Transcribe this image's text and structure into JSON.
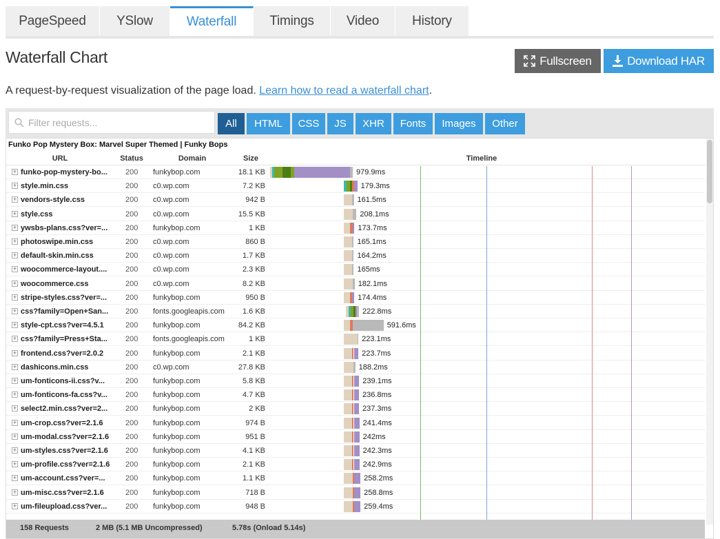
{
  "tabs": [
    {
      "label": "PageSpeed",
      "active": false
    },
    {
      "label": "YSlow",
      "active": false
    },
    {
      "label": "Waterfall",
      "active": true
    },
    {
      "label": "Timings",
      "active": false
    },
    {
      "label": "Video",
      "active": false
    },
    {
      "label": "History",
      "active": false
    }
  ],
  "heading": "Waterfall Chart",
  "buttons": {
    "fullscreen": "Fullscreen",
    "download": "Download HAR"
  },
  "description": {
    "text": "A request-by-request visualization of the page load.",
    "link": "Learn how to read a waterfall chart",
    "end": "."
  },
  "filter": {
    "placeholder": "Filter requests...",
    "types": [
      {
        "label": "All",
        "active": true
      },
      {
        "label": "HTML",
        "active": false
      },
      {
        "label": "CSS",
        "active": false
      },
      {
        "label": "JS",
        "active": false
      },
      {
        "label": "XHR",
        "active": false
      },
      {
        "label": "Fonts",
        "active": false
      },
      {
        "label": "Images",
        "active": false
      },
      {
        "label": "Other",
        "active": false
      }
    ]
  },
  "waterfall": {
    "page_title": "Funko Pop Mystery Box: Marvel Super Themed | Funky Bops",
    "columns": {
      "url": "URL",
      "status": "Status",
      "domain": "Domain",
      "size": "Size",
      "timeline": "Timeline"
    },
    "colors": {
      "blocking": "#e0d2bd",
      "dns": "#3fb8a8",
      "connect": "#7ea323",
      "ssl": "#4d7d14",
      "send": "#e07a5a",
      "wait": "#a18fc6",
      "receive": "#b9b9b9"
    },
    "timeline_ms_per_unit": 1,
    "requests": [
      {
        "url": "funko-pop-mystery-bo...",
        "status": "200",
        "domain": "funkybop.com",
        "size": "18.1 KB",
        "time": "979.9ms",
        "start": 0,
        "phases": [
          [
            "blocking",
            10
          ],
          [
            "dns",
            10
          ],
          [
            "connect",
            40
          ],
          [
            "ssl",
            40
          ],
          [
            "connect",
            15
          ],
          [
            "wait",
            270
          ],
          [
            "receive",
            15
          ]
        ]
      },
      {
        "url": "style.min.css",
        "status": "200",
        "domain": "c0.wp.com",
        "size": "7.2 KB",
        "time": "179.3ms",
        "start": 355,
        "phases": [
          [
            "dns",
            15
          ],
          [
            "connect",
            15
          ],
          [
            "ssl",
            12
          ],
          [
            "send",
            10
          ],
          [
            "wait",
            15
          ]
        ]
      },
      {
        "url": "vendors-style.css",
        "status": "200",
        "domain": "c0.wp.com",
        "size": "942 B",
        "time": "161.5ms",
        "start": 355,
        "phases": [
          [
            "blocking",
            40
          ],
          [
            "receive",
            10
          ]
        ]
      },
      {
        "url": "style.css",
        "status": "200",
        "domain": "c0.wp.com",
        "size": "15.5 KB",
        "time": "208.1ms",
        "start": 355,
        "phases": [
          [
            "blocking",
            45
          ],
          [
            "receive",
            18
          ]
        ]
      },
      {
        "url": "ywsbs-plans.css?ver=...",
        "status": "200",
        "domain": "funkybop.com",
        "size": "1 KB",
        "time": "173.7ms",
        "start": 355,
        "phases": [
          [
            "blocking",
            30
          ],
          [
            "send",
            15
          ],
          [
            "wait",
            8
          ]
        ]
      },
      {
        "url": "photoswipe.min.css",
        "status": "200",
        "domain": "c0.wp.com",
        "size": "860 B",
        "time": "165.1ms",
        "start": 355,
        "phases": [
          [
            "blocking",
            42
          ],
          [
            "receive",
            8
          ]
        ]
      },
      {
        "url": "default-skin.min.css",
        "status": "200",
        "domain": "c0.wp.com",
        "size": "1.7 KB",
        "time": "164.2ms",
        "start": 355,
        "phases": [
          [
            "blocking",
            42
          ],
          [
            "receive",
            8
          ]
        ]
      },
      {
        "url": "woocommerce-layout....",
        "status": "200",
        "domain": "c0.wp.com",
        "size": "2.3 KB",
        "time": "165ms",
        "start": 355,
        "phases": [
          [
            "blocking",
            42
          ],
          [
            "receive",
            8
          ]
        ]
      },
      {
        "url": "woocommerce.css",
        "status": "200",
        "domain": "c0.wp.com",
        "size": "8.2 KB",
        "time": "182.1ms",
        "start": 355,
        "phases": [
          [
            "blocking",
            44
          ],
          [
            "receive",
            10
          ]
        ]
      },
      {
        "url": "stripe-styles.css?ver=...",
        "status": "200",
        "domain": "funkybop.com",
        "size": "950 B",
        "time": "174.4ms",
        "start": 355,
        "phases": [
          [
            "blocking",
            30
          ],
          [
            "send",
            12
          ],
          [
            "wait",
            10
          ]
        ]
      },
      {
        "url": "css?family=Open+San...",
        "status": "200",
        "domain": "fonts.googleapis.com",
        "size": "1.6 KB",
        "time": "222.8ms",
        "start": 365,
        "phases": [
          [
            "blocking",
            15
          ],
          [
            "dns",
            10
          ],
          [
            "connect",
            12
          ],
          [
            "ssl",
            10
          ],
          [
            "wait",
            8
          ],
          [
            "receive",
            10
          ]
        ]
      },
      {
        "url": "style-cpt.css?ver=4.5.1",
        "status": "200",
        "domain": "funkybop.com",
        "size": "84.2 KB",
        "time": "591.6ms",
        "start": 355,
        "phases": [
          [
            "blocking",
            32
          ],
          [
            "send",
            12
          ],
          [
            "receive",
            150
          ]
        ]
      },
      {
        "url": "css?family=Press+Sta...",
        "status": "200",
        "domain": "fonts.googleapis.com",
        "size": "1 KB",
        "time": "223.1ms",
        "start": 355,
        "phases": [
          [
            "blocking",
            68
          ],
          [
            "receive",
            4
          ]
        ]
      },
      {
        "url": "frontend.css?ver=2.0.2",
        "status": "200",
        "domain": "funkybop.com",
        "size": "2.1 KB",
        "time": "223.7ms",
        "start": 355,
        "phases": [
          [
            "blocking",
            42
          ],
          [
            "send",
            8
          ],
          [
            "wait",
            22
          ]
        ]
      },
      {
        "url": "dashicons.min.css",
        "status": "200",
        "domain": "c0.wp.com",
        "size": "27.8 KB",
        "time": "188.2ms",
        "start": 355,
        "phases": [
          [
            "blocking",
            47
          ],
          [
            "receive",
            10
          ]
        ]
      },
      {
        "url": "um-fonticons-ii.css?v...",
        "status": "200",
        "domain": "funkybop.com",
        "size": "5.8 KB",
        "time": "239.1ms",
        "start": 355,
        "phases": [
          [
            "blocking",
            42
          ],
          [
            "send",
            8
          ],
          [
            "wait",
            26
          ]
        ]
      },
      {
        "url": "um-fonticons-fa.css?v...",
        "status": "200",
        "domain": "funkybop.com",
        "size": "4.7 KB",
        "time": "236.8ms",
        "start": 355,
        "phases": [
          [
            "blocking",
            42
          ],
          [
            "send",
            8
          ],
          [
            "wait",
            25
          ]
        ]
      },
      {
        "url": "select2.min.css?ver=2...",
        "status": "200",
        "domain": "funkybop.com",
        "size": "2 KB",
        "time": "237.3ms",
        "start": 355,
        "phases": [
          [
            "blocking",
            42
          ],
          [
            "send",
            8
          ],
          [
            "wait",
            25
          ]
        ]
      },
      {
        "url": "um-crop.css?ver=2.1.6",
        "status": "200",
        "domain": "funkybop.com",
        "size": "974 B",
        "time": "241.4ms",
        "start": 355,
        "phases": [
          [
            "blocking",
            42
          ],
          [
            "send",
            8
          ],
          [
            "wait",
            27
          ]
        ]
      },
      {
        "url": "um-modal.css?ver=2.1.6",
        "status": "200",
        "domain": "funkybop.com",
        "size": "951 B",
        "time": "242ms",
        "start": 355,
        "phases": [
          [
            "blocking",
            42
          ],
          [
            "send",
            8
          ],
          [
            "wait",
            27
          ]
        ]
      },
      {
        "url": "um-styles.css?ver=2.1.6",
        "status": "200",
        "domain": "funkybop.com",
        "size": "4.1 KB",
        "time": "242.3ms",
        "start": 355,
        "phases": [
          [
            "blocking",
            42
          ],
          [
            "send",
            8
          ],
          [
            "wait",
            27
          ]
        ]
      },
      {
        "url": "um-profile.css?ver=2.1.6",
        "status": "200",
        "domain": "funkybop.com",
        "size": "2.1 KB",
        "time": "242.9ms",
        "start": 355,
        "phases": [
          [
            "blocking",
            42
          ],
          [
            "send",
            8
          ],
          [
            "wait",
            27
          ]
        ]
      },
      {
        "url": "um-account.css?ver=...",
        "status": "200",
        "domain": "funkybop.com",
        "size": "1.1 KB",
        "time": "258.2ms",
        "start": 355,
        "phases": [
          [
            "blocking",
            44
          ],
          [
            "send",
            8
          ],
          [
            "wait",
            30
          ]
        ]
      },
      {
        "url": "um-misc.css?ver=2.1.6",
        "status": "200",
        "domain": "funkybop.com",
        "size": "718 B",
        "time": "258.8ms",
        "start": 355,
        "phases": [
          [
            "blocking",
            44
          ],
          [
            "send",
            8
          ],
          [
            "wait",
            30
          ]
        ]
      },
      {
        "url": "um-fileupload.css?ver...",
        "status": "200",
        "domain": "funkybop.com",
        "size": "948 B",
        "time": "259.4ms",
        "start": 355,
        "phases": [
          [
            "blocking",
            44
          ],
          [
            "send",
            8
          ],
          [
            "wait",
            30
          ]
        ]
      }
    ],
    "timeline_marks": [
      {
        "at": 1025,
        "color": "#78b86a"
      },
      {
        "at": 1345,
        "color": "#7aa6d9"
      },
      {
        "at": 1855,
        "color": "#d98a8a"
      },
      {
        "at": 2045,
        "color": "#b094c9"
      }
    ],
    "summary": {
      "requests": "158 Requests",
      "size": "2 MB  (5.1 MB Uncompressed)",
      "time": "5.78s  (Onload 5.14s)"
    }
  }
}
